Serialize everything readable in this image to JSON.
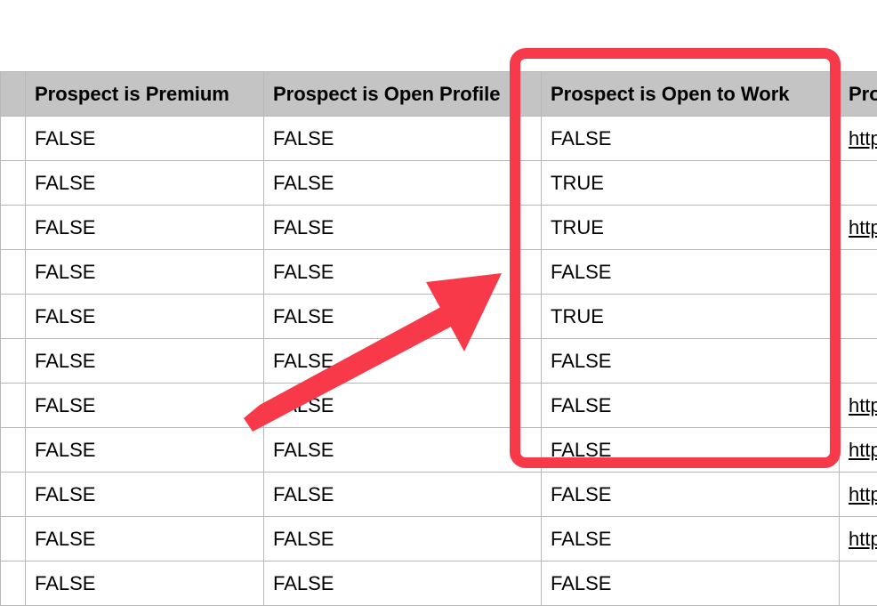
{
  "table": {
    "headers": {
      "premium": "Prospect is Premium",
      "open_profile": "Prospect is Open Profile",
      "open_to_work": "Prospect is Open to Work",
      "last": "Pro"
    },
    "rows": [
      {
        "premium": "FALSE",
        "open_profile": "FALSE",
        "open_to_work": "FALSE",
        "link": "http"
      },
      {
        "premium": "FALSE",
        "open_profile": "FALSE",
        "open_to_work": "TRUE",
        "link": ""
      },
      {
        "premium": "FALSE",
        "open_profile": "FALSE",
        "open_to_work": "TRUE",
        "link": "http"
      },
      {
        "premium": "FALSE",
        "open_profile": "FALSE",
        "open_to_work": "FALSE",
        "link": ""
      },
      {
        "premium": "FALSE",
        "open_profile": "FALSE",
        "open_to_work": "TRUE",
        "link": ""
      },
      {
        "premium": "FALSE",
        "open_profile": "FALSE",
        "open_to_work": "FALSE",
        "link": ""
      },
      {
        "premium": "FALSE",
        "open_profile": "FALSE",
        "open_to_work": "FALSE",
        "link": "http"
      },
      {
        "premium": "FALSE",
        "open_profile": "FALSE",
        "open_to_work": "FALSE",
        "link": "http"
      },
      {
        "premium": "FALSE",
        "open_profile": "FALSE",
        "open_to_work": "FALSE",
        "link": "http"
      },
      {
        "premium": "FALSE",
        "open_profile": "FALSE",
        "open_to_work": "FALSE",
        "link": "http"
      },
      {
        "premium": "FALSE",
        "open_profile": "FALSE",
        "open_to_work": "FALSE",
        "link": ""
      }
    ]
  },
  "annotation": {
    "highlight_color": "#f7394a"
  }
}
